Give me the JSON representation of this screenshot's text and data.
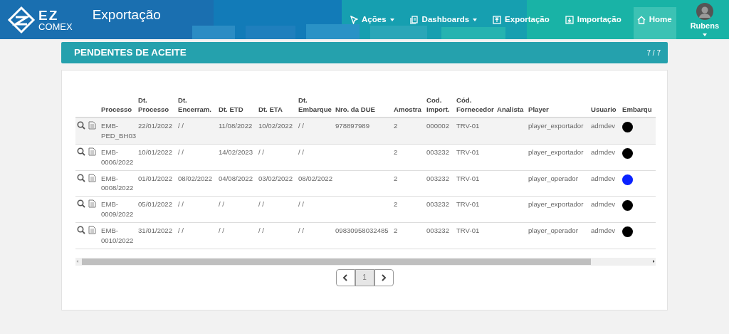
{
  "header": {
    "logo_top": "EZ",
    "logo_bottom": "COMEX",
    "title": "Exportação",
    "nav": [
      {
        "label": "Ações",
        "dropdown": true
      },
      {
        "label": "Dashboards",
        "dropdown": true
      },
      {
        "label": "Exportação",
        "dropdown": false
      },
      {
        "label": "Importação",
        "dropdown": false
      },
      {
        "label": "Home",
        "dropdown": false
      }
    ],
    "user": {
      "name": "Rubens"
    }
  },
  "panel": {
    "title": "PENDENTES DE ACEITE",
    "count": "7 / 7"
  },
  "table": {
    "columns": [
      "Processo",
      "Dt. Processo",
      "Dt. Encerram.",
      "Dt. ETD",
      "Dt. ETA",
      "Dt. Embarque",
      "Nro. da DUE",
      "Amostra",
      "Cod. Import.",
      "Cód. Fornecedor",
      "Analista",
      "Player",
      "Usuario",
      "Embarqu"
    ],
    "rows": [
      {
        "selected": true,
        "cells": [
          "EMB-PED_BH03",
          "22/01/2022",
          "/ /",
          "11/08/2022",
          "10/02/2022",
          "/ /",
          "978897989",
          "2",
          "000002",
          "TRV-01",
          "",
          "player_exportador",
          "admdev"
        ],
        "color": "#000000"
      },
      {
        "selected": false,
        "cells": [
          "EMB-0006/2022",
          "10/01/2022",
          "/ /",
          "14/02/2023",
          "/ /",
          "/ /",
          "",
          "2",
          "003232",
          "TRV-01",
          "",
          "player_exportador",
          "admdev"
        ],
        "color": "#000000"
      },
      {
        "selected": false,
        "cells": [
          "EMB-0008/2022",
          "01/01/2022",
          "08/02/2022",
          "04/08/2022",
          "03/02/2022",
          "08/02/2022",
          "",
          "2",
          "003232",
          "TRV-01",
          "",
          "player_operador",
          "admdev"
        ],
        "color": "#0a22ff"
      },
      {
        "selected": false,
        "cells": [
          "EMB-0009/2022",
          "05/01/2022",
          "/ /",
          "/ /",
          "/ /",
          "/ /",
          "",
          "2",
          "003232",
          "TRV-01",
          "",
          "player_exportador",
          "admdev"
        ],
        "color": "#000000"
      },
      {
        "selected": false,
        "cells": [
          "EMB-0010/2022",
          "31/01/2022",
          "/ /",
          "/ /",
          "/ /",
          "/ /",
          "09830958032485",
          "2",
          "003232",
          "TRV-01",
          "",
          "player_operador",
          "admdev"
        ],
        "color": "#000000"
      }
    ]
  },
  "pagination": {
    "pages": [
      {
        "label": "1",
        "selected": true
      }
    ]
  }
}
